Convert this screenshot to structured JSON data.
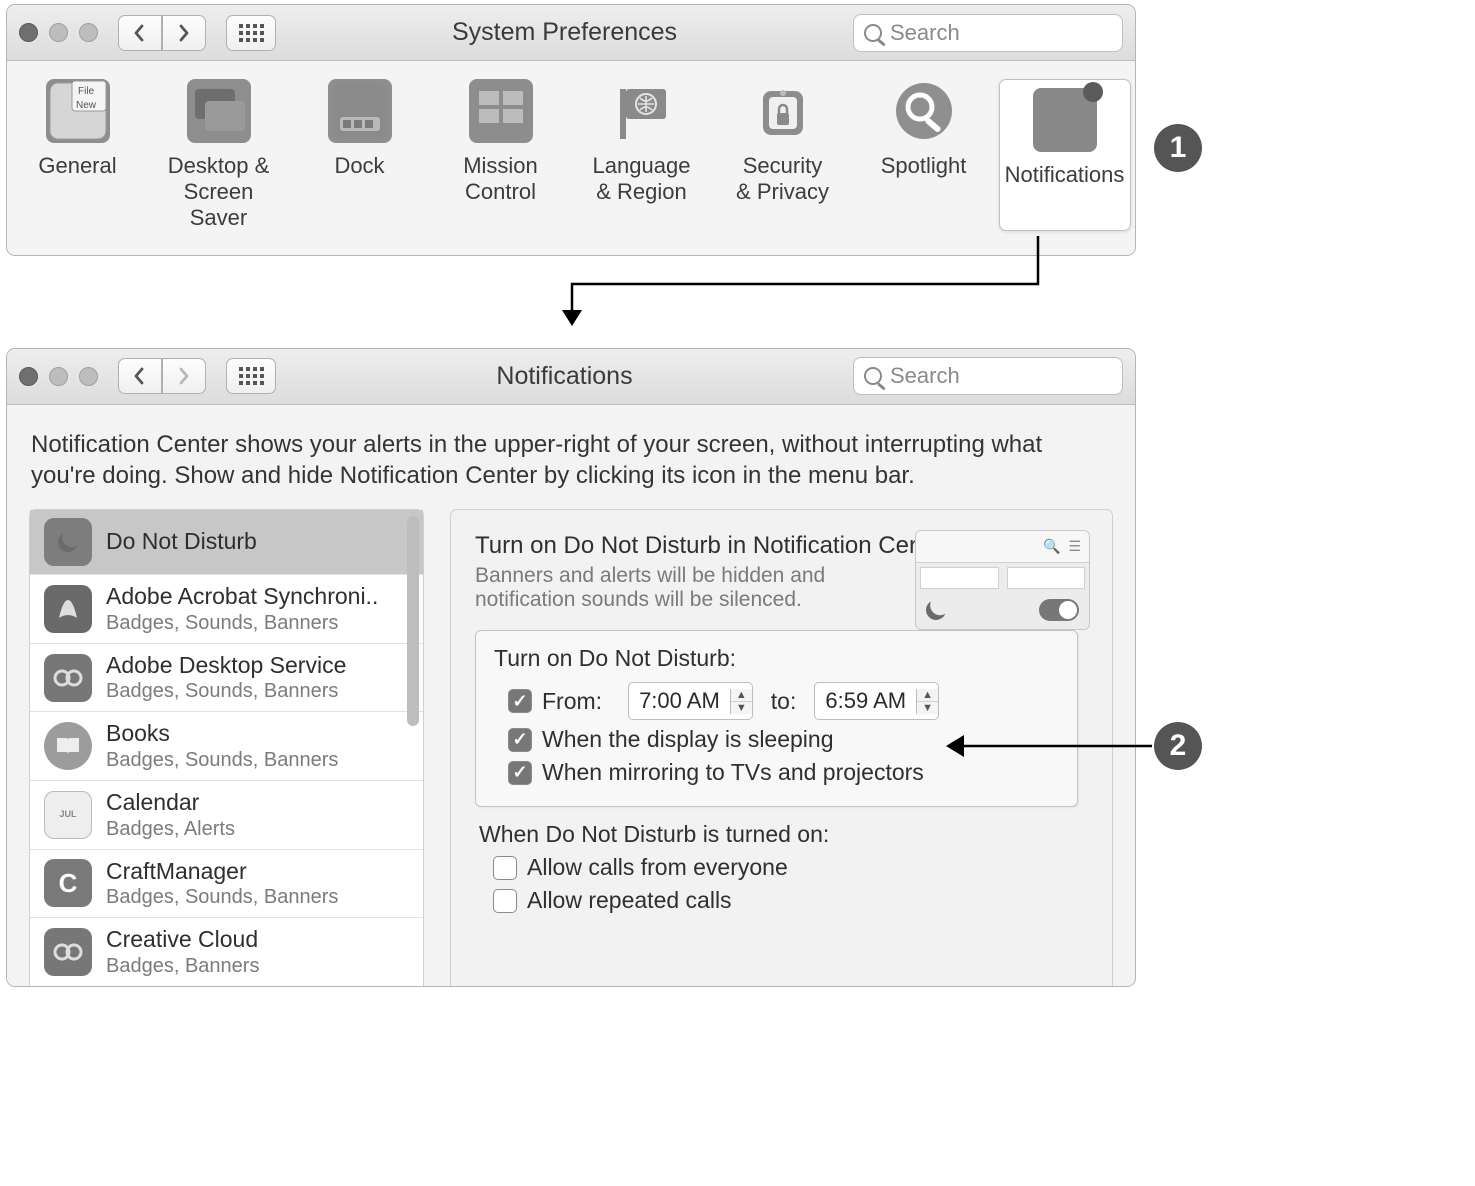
{
  "window1": {
    "title": "System Preferences",
    "search_placeholder": "Search",
    "prefs": [
      {
        "name": "General"
      },
      {
        "name": "Desktop &\nScreen Saver"
      },
      {
        "name": "Dock"
      },
      {
        "name": "Mission\nControl"
      },
      {
        "name": "Language\n& Region"
      },
      {
        "name": "Security\n& Privacy"
      },
      {
        "name": "Spotlight"
      },
      {
        "name": "Notifications"
      }
    ]
  },
  "callouts": {
    "one": "1",
    "two": "2"
  },
  "window2": {
    "title": "Notifications",
    "search_placeholder": "Search",
    "description": "Notification Center shows your alerts in the upper-right of your screen, without interrupting what you're doing. Show and hide Notification Center by clicking its icon in the menu bar.",
    "applist": [
      {
        "name": "Do Not Disturb",
        "sub": "",
        "selected": true
      },
      {
        "name": "Adobe Acrobat Synchroni..",
        "sub": "Badges, Sounds, Banners"
      },
      {
        "name": "Adobe Desktop Service",
        "sub": "Badges, Sounds, Banners"
      },
      {
        "name": "Books",
        "sub": "Badges, Sounds, Banners"
      },
      {
        "name": "Calendar",
        "sub": "Badges, Alerts"
      },
      {
        "name": "CraftManager",
        "sub": "Badges, Sounds, Banners"
      },
      {
        "name": "Creative Cloud",
        "sub": "Badges, Banners"
      }
    ],
    "panel": {
      "title": "Turn on Do Not Disturb in Notification Center",
      "sub": "Banners and alerts will be hidden and notification sounds will be silenced.",
      "section_title": "Turn on Do Not Disturb:",
      "from_label": "From:",
      "from_value": "7:00 AM",
      "to_label": "to:",
      "to_value": "6:59 AM",
      "chk_sleep": "When the display is sleeping",
      "chk_mirror": "When mirroring to TVs and projectors",
      "when_on_header": "When Do Not Disturb is turned on:",
      "chk_everyone": "Allow calls from everyone",
      "chk_repeated": "Allow repeated calls"
    }
  }
}
